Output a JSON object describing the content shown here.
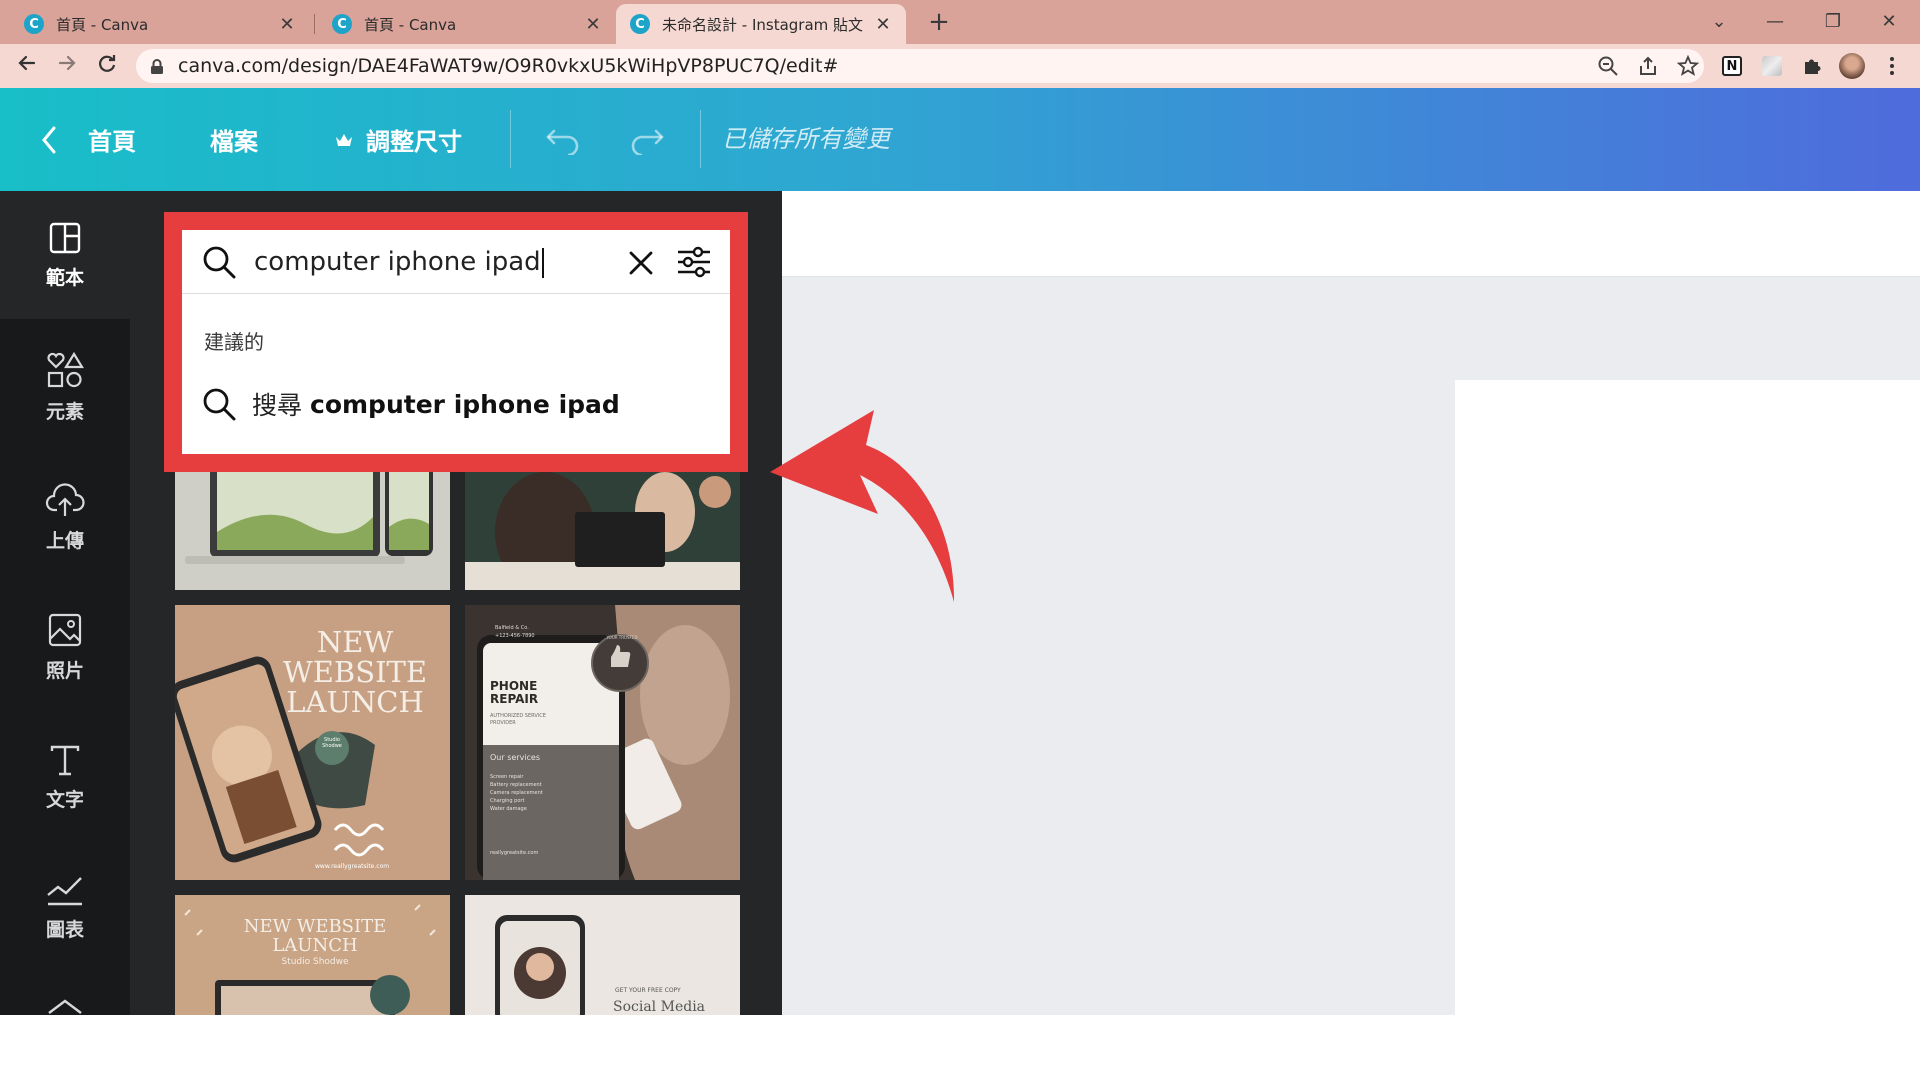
{
  "browser": {
    "tabs": [
      {
        "title": "首頁 - Canva",
        "close": "✕",
        "active": false
      },
      {
        "title": "首頁 - Canva",
        "close": "✕",
        "active": false
      },
      {
        "title": "未命名設計 - Instagram 貼文",
        "close": "✕",
        "active": true
      }
    ],
    "new_tab": "+",
    "favicon_letter": "C",
    "url": "canva.com/design/DAE4FaWAT9w/O9R0vkxU5kWiHpVP8PUC7Q/edit#",
    "window_controls": {
      "dropdown": "⌄",
      "minimize": "—",
      "restore": "❐",
      "close": "✕"
    },
    "notion_letter": "N"
  },
  "header": {
    "home_label": "首頁",
    "file_label": "檔案",
    "resize_label": "調整尺寸",
    "saved_status": "已儲存所有變更"
  },
  "sidebar": {
    "items": [
      {
        "label": "範本",
        "icon": "templates-icon"
      },
      {
        "label": "元素",
        "icon": "elements-icon"
      },
      {
        "label": "上傳",
        "icon": "upload-icon"
      },
      {
        "label": "照片",
        "icon": "photos-icon"
      },
      {
        "label": "文字",
        "icon": "text-icon"
      },
      {
        "label": "圖表",
        "icon": "charts-icon"
      }
    ]
  },
  "search": {
    "value": "computer iphone ipad",
    "suggestions_heading": "建議的",
    "suggestion_prefix": "搜尋",
    "suggestion_query": "computer iphone ipad"
  },
  "templates": {
    "thumb3": {
      "title": "NEW WEBSITE LAUNCH",
      "badge": "Studio Shodwe",
      "footer": "www.reallygreatsite.com"
    },
    "thumb4": {
      "company": "Balfield & Co.",
      "phone": "+123-456-7890",
      "title": "PHONE REPAIR",
      "subtitle": "AUTHORIZED SERVICE PROVIDER",
      "services_heading": "Our services",
      "services": [
        "Screen repair",
        "Battery replacement",
        "Camera replacement",
        "Charging port",
        "Water damage"
      ],
      "site": "reallygreatsite.com",
      "badge": "YOUR TRUSTED"
    },
    "thumb5": {
      "title": "NEW WEBSITE LAUNCH",
      "subtitle": "Studio Shodwe"
    },
    "thumb6": {
      "title": "GET YOUR FREE COPY",
      "subtitle": "Social Media"
    }
  },
  "colors": {
    "annotation_red": "#e63d3f",
    "header_gradient_start": "#18bec8",
    "header_gradient_end": "#4f6bdc",
    "browser_tabbar": "#d9a399"
  }
}
